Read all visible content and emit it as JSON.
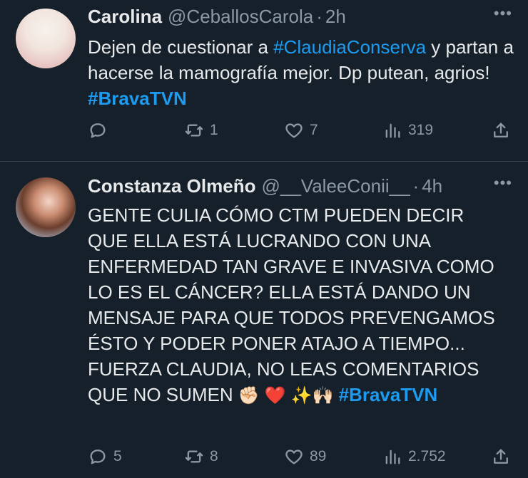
{
  "tweets": [
    {
      "name": "Carolina",
      "handle": "@CeballosCarola",
      "time": "2h",
      "text_parts": [
        "Dejen de cuestionar a ",
        "#ClaudiaConserva",
        " y partan a hacerse la mamografía mejor. Dp putean, agrios! ",
        "#BravaTVN"
      ],
      "replies": "",
      "retweets": "1",
      "likes": "7",
      "views": "319"
    },
    {
      "name": "Constanza Olmeño",
      "handle": "@__ValeeConii__",
      "time": "4h",
      "text_main": "GENTE CULIA CÓMO CTM PUEDEN DECIR QUE ELLA ESTÁ LUCRANDO CON UNA ENFERMEDAD TAN GRAVE E INVASIVA COMO LO ES EL CÁNCER? ELLA ESTÁ DANDO UN MENSAJE PARA QUE TODOS PREVENGAMOS ÉSTO Y PODER PONER ATAJO A TIEMPO... FUERZA CLAUDIA, NO LEAS COMENTARIOS QUE NO SUMEN",
      "emojis_1": "✊🏻 ❤️",
      "emojis_2": "✨🙌🏻",
      "hashtag": "#BravaTVN",
      "replies": "5",
      "retweets": "8",
      "likes": "89",
      "views": "2.752"
    }
  ],
  "icons": {
    "reply": "reply-icon",
    "retweet": "retweet-icon",
    "like": "heart-icon",
    "views": "views-icon",
    "share": "share-icon",
    "more": "more-icon"
  },
  "colors": {
    "background": "#15202b",
    "text": "#e7e9ea",
    "muted": "#8b98a5",
    "accent": "#1d9bf0",
    "divider": "#38444d"
  }
}
